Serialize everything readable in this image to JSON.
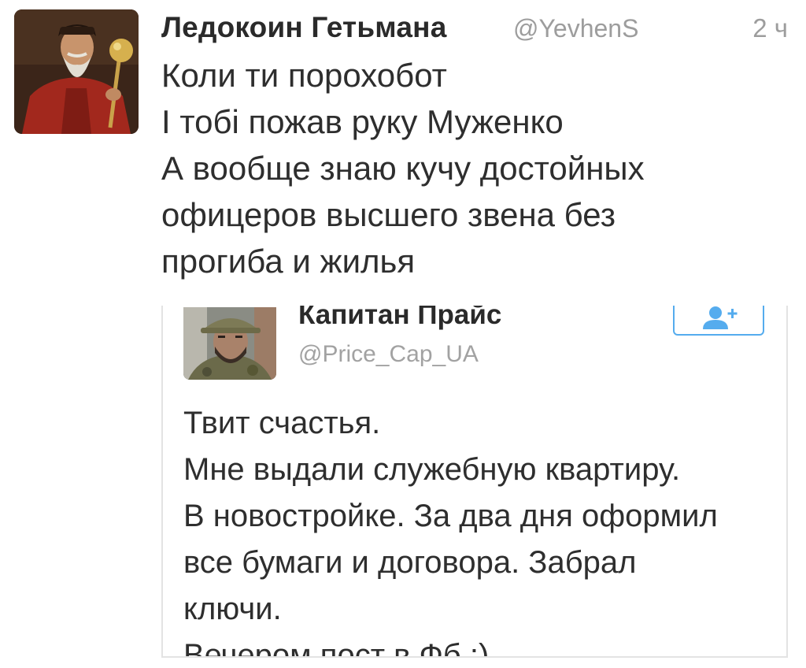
{
  "tweet": {
    "display_name": "Ледокоин Гетьмана",
    "handle": "@YevhenS",
    "timestamp": "2 ч",
    "avatar_icon": "portrait-hetman-avatar",
    "text_lines": [
      "Коли ти порохобот",
      "І тобі пожав руку Муженко",
      "А вообще знаю кучу достойных",
      "офицеров высшего звена без",
      "прогиба и жилья"
    ]
  },
  "quoted_tweet": {
    "display_name": "Капитан Прайс",
    "handle": "@Price_Cap_UA",
    "avatar_icon": "soldier-photo-avatar",
    "follow_icon": "follow-user-plus-icon",
    "text_lines": [
      "Твит счастья.",
      "Мне выдали служебную квартиру.",
      "В новостройке. За два дня оформил",
      "все бумаги и договора. Забрал",
      "ключи.",
      "Вечером пост в Фб :)"
    ]
  },
  "colors": {
    "accent": "#55acee",
    "text": "#2e2e2e",
    "muted": "#9d9d9d",
    "border": "#e3e3e3"
  }
}
